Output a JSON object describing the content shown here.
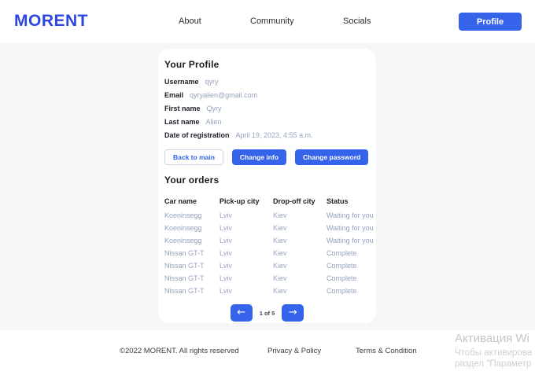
{
  "brand": {
    "logo": "MORENT",
    "accent_color": "#3563E9"
  },
  "header": {
    "nav": [
      {
        "label": "About"
      },
      {
        "label": "Community"
      },
      {
        "label": "Socials"
      }
    ],
    "profile_button_label": "Profile"
  },
  "profile": {
    "title": "Your Profile",
    "fields": [
      {
        "label": "Username",
        "value": "qyry"
      },
      {
        "label": "Email",
        "value": "qyryalien@gmail.com"
      },
      {
        "label": "First name",
        "value": "Qyry"
      },
      {
        "label": "Last name",
        "value": "Alien"
      },
      {
        "label": "Date of registration",
        "value": "April 19, 2023, 4:55 a.m."
      }
    ],
    "buttons": {
      "back_to_main": "Back to main",
      "change_info": "Change info",
      "change_password": "Change password"
    }
  },
  "orders": {
    "title": "Your orders",
    "columns": [
      "Car name",
      "Pick-up city",
      "Drop-off city",
      "Status"
    ],
    "rows": [
      [
        "Koeninsegg",
        "Lviv",
        "Kiev",
        "Waiting for you"
      ],
      [
        "Koeninsegg",
        "Lviv",
        "Kiev",
        "Waiting for you"
      ],
      [
        "Koeninsegg",
        "Lviv",
        "Kiev",
        "Waiting for you"
      ],
      [
        "Nissan GT-T",
        "Lviv",
        "Kiev",
        "Complete"
      ],
      [
        "Nissan GT-T",
        "Lviv",
        "Kiev",
        "Complete"
      ],
      [
        "Nissan GT-T",
        "Lviv",
        "Kiev",
        "Complete"
      ],
      [
        "Nissan GT-T",
        "Lviv",
        "Kiev",
        "Complete"
      ]
    ],
    "pagination": {
      "label": "1 of 5",
      "prev_icon": "←",
      "next_icon": "→"
    }
  },
  "footer": {
    "copyright": "©2022 MORENT. All rights reserved",
    "privacy": "Privacy & Policy",
    "terms": "Terms & Condition"
  },
  "watermark": {
    "line1": "Активация Wi",
    "line2": "Чтобы активирова",
    "line3": "раздел \"Параметр"
  },
  "colors": {
    "accent": "#3563E9",
    "page_background": "#f6f6f9",
    "muted_value_text": "#96a3bf",
    "watermark_gray": "#c6c6c6"
  }
}
